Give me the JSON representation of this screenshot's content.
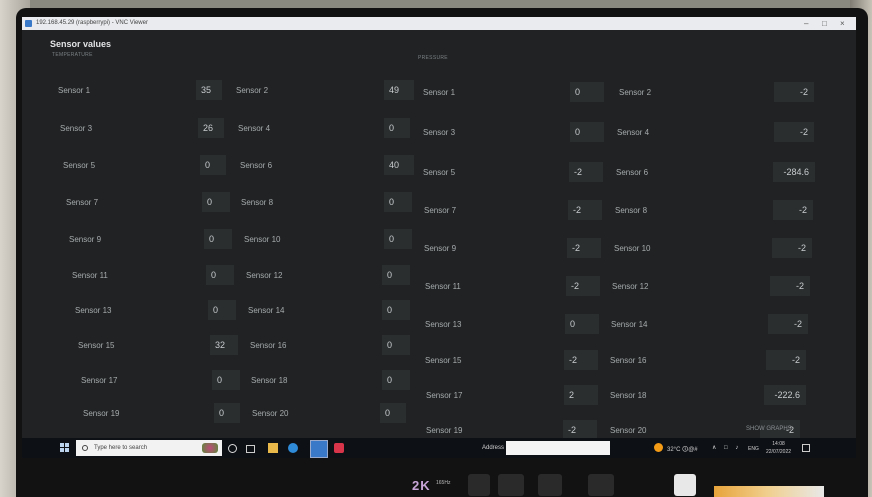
{
  "window": {
    "title": "192.168.45.29 (raspberrypi) - VNC Viewer"
  },
  "app": {
    "title": "Sensor values",
    "temperature_label": "TEMPERATURE",
    "pressure_label": "PRESSURE",
    "show_graphs": "SHOW GRAPHS",
    "temperature": [
      {
        "label": "Sensor 1",
        "value": "35"
      },
      {
        "label": "Sensor 2",
        "value": "49"
      },
      {
        "label": "Sensor 3",
        "value": "26"
      },
      {
        "label": "Sensor 4",
        "value": "0"
      },
      {
        "label": "Sensor 5",
        "value": "0"
      },
      {
        "label": "Sensor 6",
        "value": "40"
      },
      {
        "label": "Sensor 7",
        "value": "0"
      },
      {
        "label": "Sensor 8",
        "value": "0"
      },
      {
        "label": "Sensor 9",
        "value": "0"
      },
      {
        "label": "Sensor 10",
        "value": "0"
      },
      {
        "label": "Sensor 11",
        "value": "0"
      },
      {
        "label": "Sensor 12",
        "value": "0"
      },
      {
        "label": "Sensor 13",
        "value": "0"
      },
      {
        "label": "Sensor 14",
        "value": "0"
      },
      {
        "label": "Sensor 15",
        "value": "32"
      },
      {
        "label": "Sensor 16",
        "value": "0"
      },
      {
        "label": "Sensor 17",
        "value": "0"
      },
      {
        "label": "Sensor 18",
        "value": "0"
      },
      {
        "label": "Sensor 19",
        "value": "0"
      },
      {
        "label": "Sensor 20",
        "value": "0"
      }
    ],
    "pressure": [
      {
        "label": "Sensor 1",
        "value": "0"
      },
      {
        "label": "Sensor 2",
        "value": "-2"
      },
      {
        "label": "Sensor 3",
        "value": "0"
      },
      {
        "label": "Sensor 4",
        "value": "-2"
      },
      {
        "label": "Sensor 5",
        "value": "-2"
      },
      {
        "label": "Sensor 6",
        "value": "-284.6"
      },
      {
        "label": "Sensor 7",
        "value": "-2"
      },
      {
        "label": "Sensor 8",
        "value": "-2"
      },
      {
        "label": "Sensor 9",
        "value": "-2"
      },
      {
        "label": "Sensor 10",
        "value": "-2"
      },
      {
        "label": "Sensor 11",
        "value": "-2"
      },
      {
        "label": "Sensor 12",
        "value": "-2"
      },
      {
        "label": "Sensor 13",
        "value": "0"
      },
      {
        "label": "Sensor 14",
        "value": "-2"
      },
      {
        "label": "Sensor 15",
        "value": "-2"
      },
      {
        "label": "Sensor 16",
        "value": "-2"
      },
      {
        "label": "Sensor 17",
        "value": "2"
      },
      {
        "label": "Sensor 18",
        "value": "-222.6"
      },
      {
        "label": "Sensor 19",
        "value": "-2"
      },
      {
        "label": "Sensor 20",
        "value": "-2"
      }
    ]
  },
  "taskbar": {
    "search_placeholder": "Type here to search",
    "address_label": "Address",
    "weather": "32°C 🛈@#",
    "lang": "ENG",
    "time": "14:08",
    "date": "22/07/2022"
  },
  "laptop": {
    "logo": "2K",
    "logo_sub": "165Hz"
  },
  "colors": {
    "accent": "#3a79c8",
    "app_bg": "#202223",
    "value_box": "#2b2e2f",
    "weather": "#f39a16"
  }
}
